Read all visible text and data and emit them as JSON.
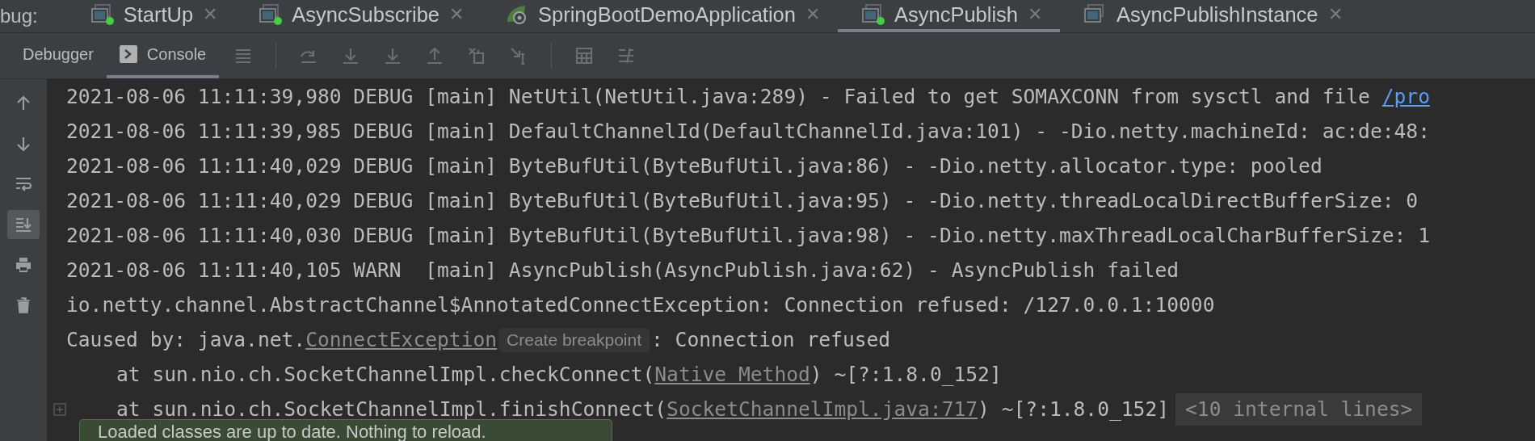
{
  "debug_label": "bug:",
  "run_tabs": [
    {
      "label": "StartUp",
      "kind": "app",
      "running": true,
      "selected": false
    },
    {
      "label": "AsyncSubscribe",
      "kind": "app",
      "running": true,
      "selected": false
    },
    {
      "label": "SpringBootDemoApplication",
      "kind": "spring",
      "running": false,
      "selected": false
    },
    {
      "label": "AsyncPublish",
      "kind": "app",
      "running": true,
      "selected": true
    },
    {
      "label": "AsyncPublishInstance",
      "kind": "app",
      "running": false,
      "selected": false
    }
  ],
  "tool_tabs": [
    {
      "label": "Debugger",
      "kind": "plain",
      "selected": false
    },
    {
      "label": "Console",
      "kind": "console",
      "selected": true
    }
  ],
  "gutter": [
    {
      "kind": "up",
      "selected": false
    },
    {
      "kind": "down",
      "selected": false
    },
    {
      "kind": "wrap",
      "selected": false
    },
    {
      "kind": "scroll-end",
      "selected": true
    },
    {
      "kind": "print",
      "selected": false
    },
    {
      "kind": "trash",
      "selected": false
    }
  ],
  "lines": [
    {
      "kind": "log",
      "foldable": false,
      "segments": [
        {
          "kind": "text",
          "text": "2021-08-06 11:11:39,980 DEBUG [main] NetUtil(NetUtil.java:289) - Failed to get SOMAXCONN from sysctl and file "
        },
        {
          "kind": "url",
          "text": "/pro"
        }
      ]
    },
    {
      "kind": "log",
      "foldable": false,
      "segments": [
        {
          "kind": "text",
          "text": "2021-08-06 11:11:39,985 DEBUG [main] DefaultChannelId(DefaultChannelId.java:101) - -Dio.netty.machineId: ac:de:48:"
        }
      ]
    },
    {
      "kind": "log",
      "foldable": false,
      "segments": [
        {
          "kind": "text",
          "text": "2021-08-06 11:11:40,029 DEBUG [main] ByteBufUtil(ByteBufUtil.java:86) - -Dio.netty.allocator.type: pooled"
        }
      ]
    },
    {
      "kind": "log",
      "foldable": false,
      "segments": [
        {
          "kind": "text",
          "text": "2021-08-06 11:11:40,029 DEBUG [main] ByteBufUtil(ByteBufUtil.java:95) - -Dio.netty.threadLocalDirectBufferSize: 0"
        }
      ]
    },
    {
      "kind": "log",
      "foldable": false,
      "segments": [
        {
          "kind": "text",
          "text": "2021-08-06 11:11:40,030 DEBUG [main] ByteBufUtil(ByteBufUtil.java:98) - -Dio.netty.maxThreadLocalCharBufferSize: 1"
        }
      ]
    },
    {
      "kind": "log",
      "foldable": false,
      "segments": [
        {
          "kind": "text",
          "text": "2021-08-06 11:11:40,105 WARN  [main] AsyncPublish(AsyncPublish.java:62) - AsyncPublish failed"
        }
      ]
    },
    {
      "kind": "log",
      "foldable": false,
      "segments": [
        {
          "kind": "text",
          "text": "io.netty.channel.AbstractChannel$AnnotatedConnectException: Connection refused: /127.0.0.1:10000"
        }
      ]
    },
    {
      "kind": "log",
      "foldable": false,
      "segments": [
        {
          "kind": "text",
          "text": "Caused by: java.net."
        },
        {
          "kind": "link",
          "text": "ConnectException"
        },
        {
          "kind": "hint",
          "text": "Create breakpoint"
        },
        {
          "kind": "text",
          "text": ": Connection refused"
        }
      ]
    },
    {
      "kind": "stack",
      "foldable": false,
      "segments": [
        {
          "kind": "text",
          "text": "at sun.nio.ch.SocketChannelImpl.checkConnect("
        },
        {
          "kind": "link",
          "text": "Native Method"
        },
        {
          "kind": "text",
          "text": ") ~[?:1.8.0_152]"
        }
      ]
    },
    {
      "kind": "stack",
      "foldable": true,
      "segments": [
        {
          "kind": "text",
          "text": "at sun.nio.ch.SocketChannelImpl.finishConnect("
        },
        {
          "kind": "link",
          "text": "SocketChannelImpl.java:717"
        },
        {
          "kind": "text",
          "text": ") ~[?:1.8.0_152]"
        },
        {
          "kind": "fold",
          "text": "<10 internal lines>"
        }
      ]
    }
  ],
  "close_glyph": "✕",
  "toast": {
    "message": "Loaded classes are up to date. Nothing to reload."
  }
}
